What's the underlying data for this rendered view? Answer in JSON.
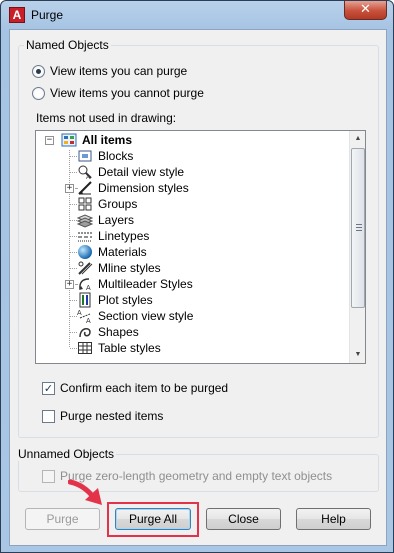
{
  "window": {
    "title": "Purge",
    "app_icon_letter": "A"
  },
  "named_objects": {
    "group_label": "Named Objects",
    "radio_view_can": "View items you can purge",
    "radio_view_cannot": "View items you cannot purge",
    "tree_caption": "Items not used in drawing:",
    "tree": {
      "root": "All items",
      "items": [
        {
          "label": "Blocks",
          "icon": "blocks-icon"
        },
        {
          "label": "Detail view style",
          "icon": "detail-view-style-icon"
        },
        {
          "label": "Dimension styles",
          "icon": "dimension-styles-icon"
        },
        {
          "label": "Groups",
          "icon": "groups-icon"
        },
        {
          "label": "Layers",
          "icon": "layers-icon"
        },
        {
          "label": "Linetypes",
          "icon": "linetypes-icon"
        },
        {
          "label": "Materials",
          "icon": "materials-icon"
        },
        {
          "label": "Mline styles",
          "icon": "mline-styles-icon"
        },
        {
          "label": "Multileader Styles",
          "icon": "multileader-styles-icon"
        },
        {
          "label": "Plot styles",
          "icon": "plot-styles-icon"
        },
        {
          "label": "Section view style",
          "icon": "section-view-style-icon"
        },
        {
          "label": "Shapes",
          "icon": "shapes-icon"
        },
        {
          "label": "Table styles",
          "icon": "table-styles-icon"
        }
      ]
    },
    "confirm_each": "Confirm each item to be purged",
    "purge_nested": "Purge nested items"
  },
  "unnamed_objects": {
    "group_label": "Unnamed Objects",
    "purge_zero_length": "Purge zero-length geometry and empty text objects"
  },
  "buttons": {
    "purge": "Purge",
    "purge_all": "Purge All",
    "close": "Close",
    "help": "Help"
  },
  "colors": {
    "highlight": "#e3334b",
    "arrow": "#e3334b"
  }
}
